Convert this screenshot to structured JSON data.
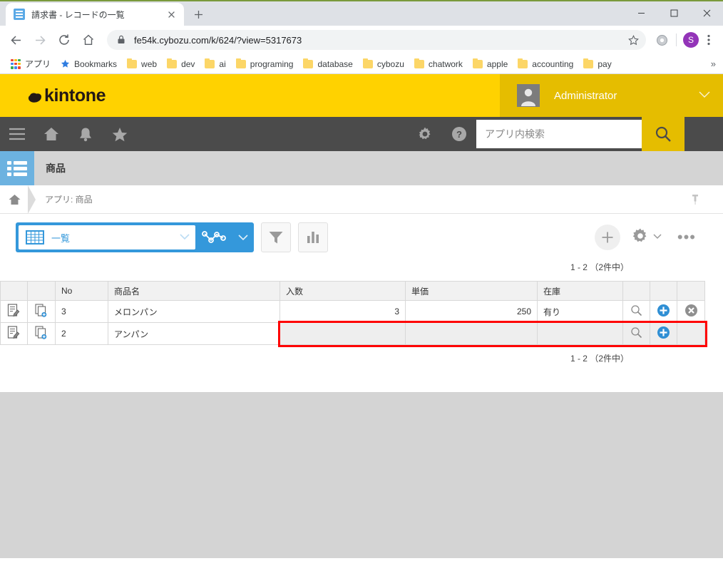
{
  "browser": {
    "tab": {
      "title": "請求書 - レコードの一覧",
      "favicon": "list-icon",
      "close_label": "✕"
    },
    "new_tab_label": "+",
    "window_controls": {
      "minimize": "minimize-icon",
      "maximize": "maximize-icon",
      "close": "close-icon"
    },
    "nav": {
      "back": "←",
      "forward": "→",
      "reload": "⟳",
      "home": "⌂"
    },
    "omnibox": {
      "url": "fe54k.cybozu.com/k/624/?view=5317673",
      "lock": "lock-icon",
      "star": "star-icon"
    },
    "profile_initial": "S",
    "menu": "⋮",
    "bookmarks": [
      {
        "label": "アプリ",
        "icon": "apps-grid-icon"
      },
      {
        "label": "Bookmarks",
        "icon": "star-icon"
      },
      {
        "label": "web",
        "icon": "folder-icon"
      },
      {
        "label": "dev",
        "icon": "folder-icon"
      },
      {
        "label": "ai",
        "icon": "folder-icon"
      },
      {
        "label": "programing",
        "icon": "folder-icon"
      },
      {
        "label": "database",
        "icon": "folder-icon"
      },
      {
        "label": "cybozu",
        "icon": "folder-icon"
      },
      {
        "label": "chatwork",
        "icon": "folder-icon"
      },
      {
        "label": "apple",
        "icon": "folder-icon"
      },
      {
        "label": "accounting",
        "icon": "folder-icon"
      },
      {
        "label": "pay",
        "icon": "folder-icon"
      }
    ],
    "bookmarks_overflow": "»"
  },
  "kintone": {
    "logo_text": "kintone",
    "user": {
      "name": "Administrator",
      "avatar": "person-avatar",
      "caret": "chevron-down-icon"
    },
    "nav_icons": [
      "hamburger-icon",
      "home-icon",
      "bell-icon",
      "star-icon"
    ],
    "nav_right_icons": [
      "gear-icon",
      "help-icon"
    ],
    "search": {
      "placeholder": "アプリ内検索",
      "value": "",
      "button_icon": "search-icon"
    },
    "app": {
      "icon": "list-app-icon",
      "name": "商品"
    },
    "breadcrumb": {
      "home_icon": "home-icon",
      "text": "アプリ: 商品",
      "pin_icon": "pin-icon"
    },
    "toolbar": {
      "view_label": "一覧",
      "view_icon": "table-grid-icon",
      "view_caret": "chevron-down-icon",
      "graph_icon": "graph-line-icon",
      "graph_caret": "chevron-down-icon",
      "filter_icon": "funnel-icon",
      "chart_icon": "bar-chart-icon",
      "add_label": "＋",
      "gear_icon": "gear-icon",
      "gear_caret": "chevron-down-icon",
      "more_label": "•••"
    },
    "record_count_top": "1 - 2 （2件中）",
    "record_count_bottom": "1 - 2 （2件中）",
    "table": {
      "columns": [
        "",
        "",
        "No",
        "商品名",
        "入数",
        "単価",
        "在庫",
        "",
        "",
        ""
      ],
      "rows": [
        {
          "edit_icon": "edit-record-icon",
          "copy_icon": "copy-record-icon",
          "no": "3",
          "name": "メロンパン",
          "qty": "3",
          "price": "250",
          "stock": "有り",
          "lens_icon": "search-small-icon",
          "plus_icon": "add-circle-icon",
          "delete_icon": "remove-circle-icon",
          "highlighted": false
        },
        {
          "edit_icon": "edit-record-icon",
          "copy_icon": "copy-record-icon",
          "no": "2",
          "name": "アンパン",
          "qty": "",
          "price": "",
          "stock": "",
          "lens_icon": "search-small-icon",
          "plus_icon": "add-circle-icon",
          "delete_icon": "",
          "highlighted": true
        }
      ]
    }
  },
  "annotation": {
    "highlight_color": "#ff0000"
  }
}
